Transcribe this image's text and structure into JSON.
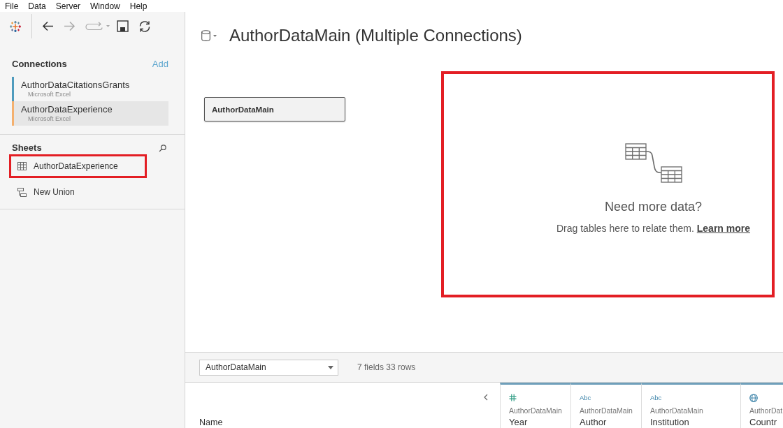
{
  "menu_bar": [
    "File",
    "Data",
    "Server",
    "Window",
    "Help"
  ],
  "toolbar": [
    {
      "kind": "back",
      "disabled": false
    },
    {
      "kind": "forward",
      "disabled": true
    },
    {
      "kind": "redo",
      "disabled": true
    },
    {
      "kind": "save",
      "disabled": false
    },
    {
      "kind": "refresh",
      "disabled": false
    }
  ],
  "connections": {
    "title": "Connections",
    "add": "Add",
    "items": [
      {
        "name": "AuthorDataCitationsGrants",
        "type": "Microsoft Excel",
        "color": "#4f9bbd",
        "selected": false
      },
      {
        "name": "AuthorDataExperience",
        "type": "Microsoft Excel",
        "color": "#f4b06e",
        "selected": true
      }
    ]
  },
  "sheets": {
    "title": "Sheets",
    "items": [
      {
        "kind": "table",
        "label": "AuthorDataExperience",
        "highlighted": true
      },
      {
        "kind": "union",
        "label": "New Union",
        "highlighted": false
      }
    ]
  },
  "canvas": {
    "title": "AuthorDataMain (Multiple Connections)",
    "tables": [
      {
        "label": "AuthorDataMain"
      }
    ],
    "drop_zone": {
      "heading": "Need more data?",
      "text": "Drag tables here to relate them.",
      "link": "Learn more",
      "highlighted": true
    }
  },
  "preview": {
    "table_select": "AuthorDataMain",
    "summary": "7 fields 33 rows",
    "row_label": "Name",
    "columns": [
      {
        "kind": "number",
        "source": "AuthorDataMain",
        "name": "Year"
      },
      {
        "kind": "string",
        "type_label": "Abc",
        "source": "AuthorDataMain",
        "name": "Author"
      },
      {
        "kind": "string",
        "type_label": "Abc",
        "source": "AuthorDataMain",
        "name": "Institution"
      },
      {
        "kind": "geo",
        "source": "AuthorDat",
        "name": "Countr"
      }
    ]
  }
}
